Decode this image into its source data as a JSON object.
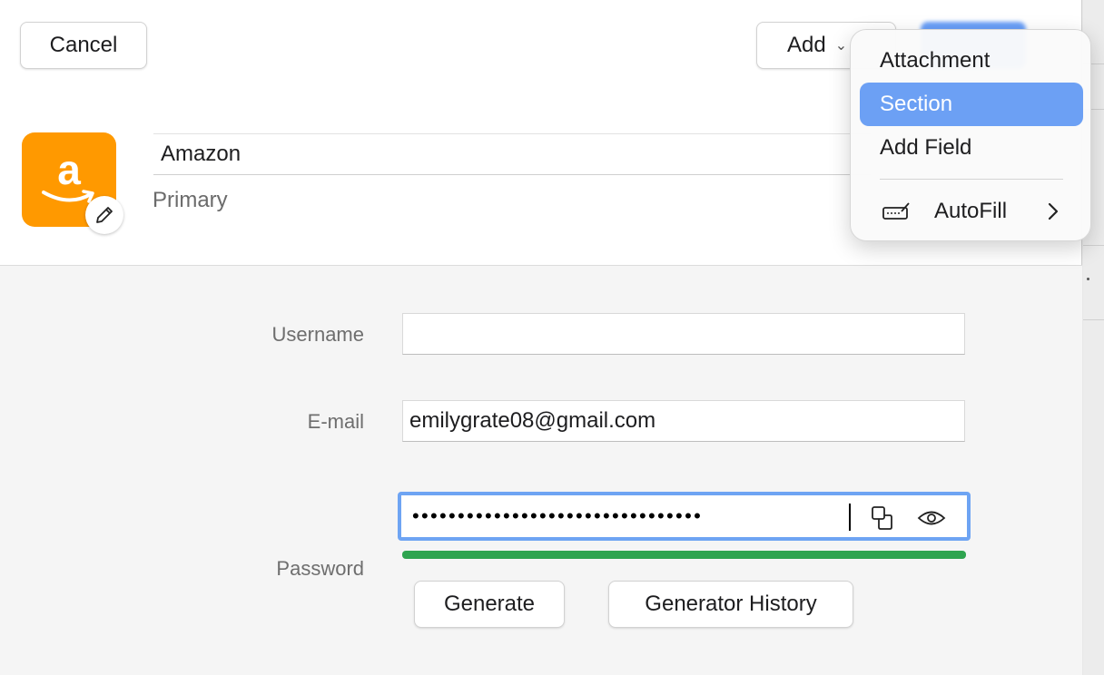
{
  "toolbar": {
    "cancel_label": "Cancel",
    "add_label": "Add"
  },
  "item": {
    "icon_letter": "a",
    "title": "Amazon",
    "subtitle": "Primary"
  },
  "form": {
    "username_label": "Username",
    "username_value": "",
    "email_label": "E-mail",
    "email_value": "emilygrate08@gmail.com",
    "password_label": "Password",
    "password_masked": "••••••••••••••••••••••••••••••••",
    "password_strength": 1.0,
    "generate_label": "Generate",
    "history_label": "Generator History"
  },
  "menu": {
    "items": [
      "Attachment",
      "Section",
      "Add Field"
    ],
    "active_item": "Section",
    "autofill_label": "AutoFill"
  },
  "colors": {
    "accent": "#6ca0f4",
    "brand_orange": "#ff9900",
    "strength_green": "#2ea44f"
  }
}
